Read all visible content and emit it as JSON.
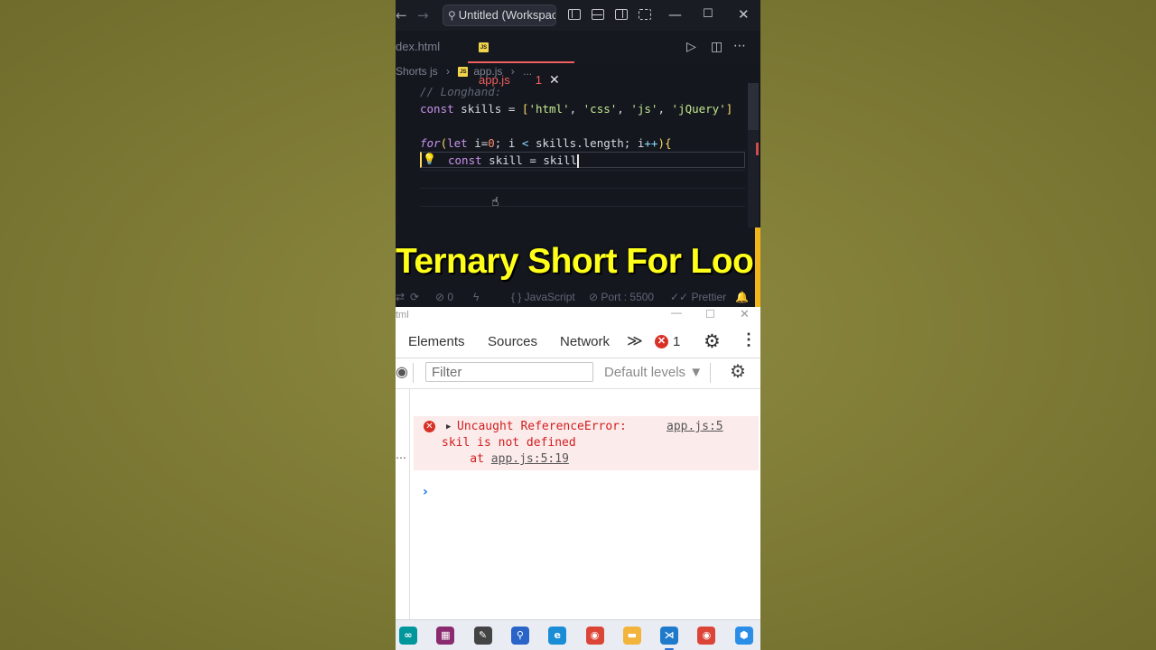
{
  "titlebar": {
    "command_center": "Untitled (Workspace",
    "back_icon": "arrow-left-icon",
    "forward_icon": "arrow-right-icon",
    "window_controls": [
      "—",
      "☐",
      "✕"
    ]
  },
  "tabs": {
    "inactive": "dex.html",
    "active_label": "app.js",
    "active_badge": "JS",
    "active_errors": "1",
    "close": "✕"
  },
  "breadcrumb": {
    "folder": "Shorts js",
    "badge": "JS",
    "file": "app.js",
    "more": "..."
  },
  "code": {
    "comment": "// Longhand:",
    "line2": {
      "kw": "const",
      "name": " skills = ",
      "open": "[",
      "s1": "'html'",
      "s2": "'css'",
      "s3": "'js'",
      "s4": "'jQuery'",
      "comma": ", ",
      "close": "]"
    },
    "line4": {
      "kw": "for",
      "open": "(",
      "let": "let",
      "a": " i=",
      "zero": "0",
      "b": "; i ",
      "lt": "<",
      "c": " skills.length; i",
      "inc": "++",
      "close": ")",
      "brace": "{"
    },
    "line5": {
      "kw": "const",
      "rest": " skill = skill"
    }
  },
  "overlay": {
    "title": "Ternary Short For Loop"
  },
  "statusbar": {
    "ports": "⊘ 0",
    "language": "{ } JavaScript",
    "port": "⊘ Port : 5500",
    "prettier": "✓✓ Prettier"
  },
  "devtools": {
    "window_title": "tml",
    "tabs": [
      "Elements",
      "Sources",
      "Network"
    ],
    "more": "≫",
    "error_count": "1",
    "filter_placeholder": "Filter",
    "levels": "Default levels ▼",
    "error": {
      "line1": "Uncaught ReferenceError:",
      "source": "app.js:5",
      "line2": "skil is not defined",
      "at": "    at ",
      "stack_link": "app.js:5:19"
    },
    "prompt": "›",
    "side_dots": "…"
  },
  "taskbar": {
    "apps": [
      {
        "name": "arduino-icon",
        "color": "#00979c",
        "glyph": "∞"
      },
      {
        "name": "winrar-icon",
        "color": "#8a2b6f",
        "glyph": "▦"
      },
      {
        "name": "pen-icon",
        "color": "#444444",
        "glyph": "✎"
      },
      {
        "name": "search-app-icon",
        "color": "#2a64c8",
        "glyph": "⚲"
      },
      {
        "name": "edge-icon",
        "color": "#1a8dd6",
        "glyph": "e"
      },
      {
        "name": "chrome-icon",
        "color": "#db4437",
        "glyph": "◉"
      },
      {
        "name": "file-explorer-icon",
        "color": "#f2b43a",
        "glyph": "▬"
      },
      {
        "name": "vscode-icon",
        "color": "#1f7acc",
        "glyph": "⋊"
      },
      {
        "name": "chrome-2-icon",
        "color": "#db4437",
        "glyph": "◉"
      },
      {
        "name": "store-icon",
        "color": "#2b8ee6",
        "glyph": "⬢"
      }
    ]
  }
}
